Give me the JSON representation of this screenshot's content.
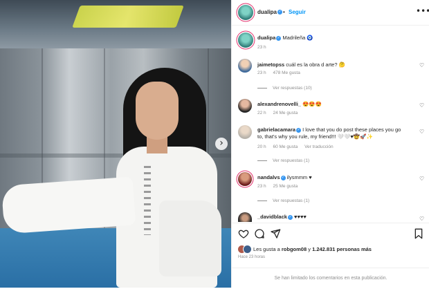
{
  "post": {
    "author": "dualipa",
    "follow_label": "Seguir",
    "separator": "•",
    "more_label": "•••",
    "next_label": "›"
  },
  "caption": {
    "author": "dualipa",
    "text": "Madrileña",
    "emoji": "🧿",
    "time": "23 h"
  },
  "comments": [
    {
      "author": "jaimetopss",
      "text": "cuál es la obra d arte? 🤔",
      "time": "23 h",
      "likes": "478 Me gusta",
      "replies": "Ver respuestas (10)"
    },
    {
      "author": "alexandrenovelli_",
      "text": "😍😍😍",
      "time": "22 h",
      "likes": "24 Me gusta",
      "replies": ""
    },
    {
      "author": "gabrielacamara",
      "verified": true,
      "text": "I love that you do post these places you go to, that's why you rule, my friend!!! 🤍🤍♥🤠🚀✨",
      "time": "20 h",
      "likes": "60 Me gusta",
      "extra": "Ver traducción",
      "replies": "Ver respuestas (1)"
    },
    {
      "author": "nandalvs",
      "verified": true,
      "text": "ilysmmm ♥",
      "time": "23 h",
      "likes": "25 Me gusta",
      "replies": "Ver respuestas (1)"
    },
    {
      "author": "_davidblack",
      "verified": true,
      "text": "♥♥♥♥",
      "time": "",
      "likes": "",
      "replies": ""
    }
  ],
  "actions": {
    "likes_prefix": "Les gusta a ",
    "likes_user": "robgom08",
    "likes_middle": " y ",
    "likes_count": "1.242.831 personas más",
    "time_ago": "Hace 23 horas",
    "comments_limited": "Se han limitado los comentarios en esta publicación."
  },
  "colors": {
    "accent": "#0095f6",
    "verified": "#3897f0",
    "muted": "#8e8e8e"
  }
}
